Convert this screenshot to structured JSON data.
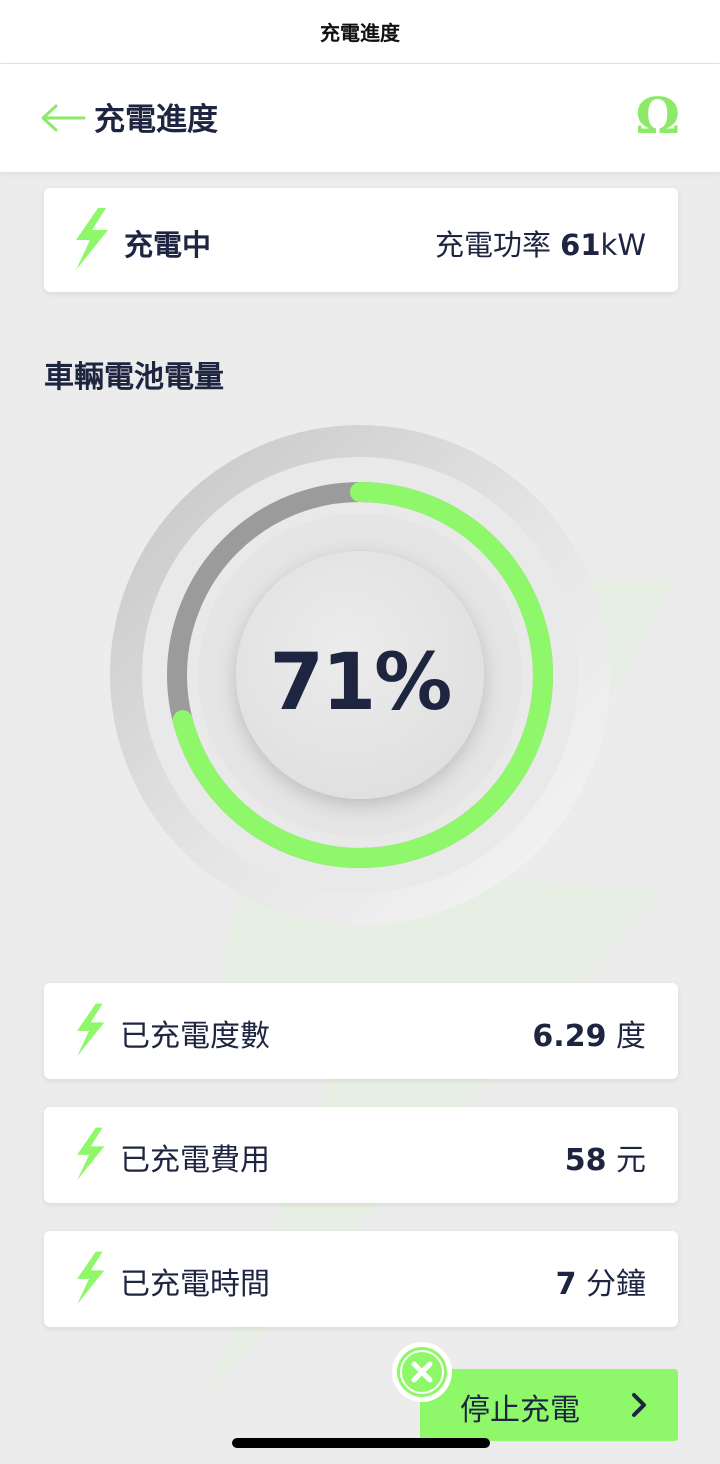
{
  "system": {
    "title": "充電進度"
  },
  "header": {
    "title": "充電進度",
    "omega": "Ω"
  },
  "status": {
    "label": "充電中",
    "power_label": "充電功率",
    "power_value": "61",
    "power_unit": "kW"
  },
  "battery": {
    "section_title": "車輛電池電量",
    "percent_text": "71%",
    "percent_value": 71
  },
  "stats": [
    {
      "label": "已充電度數",
      "value": "6.29",
      "unit": "度"
    },
    {
      "label": "已充電費用",
      "value": "58",
      "unit": "元"
    },
    {
      "label": "已充電時間",
      "value": "7",
      "unit": "分鐘"
    }
  ],
  "stop": {
    "label": "停止充電"
  },
  "colors": {
    "accent_green": "#8ef86a",
    "text_dark": "#1e2540",
    "background": "#ececec"
  },
  "icons": {
    "back": "arrow-left-icon",
    "omega": "omega-icon",
    "bolt": "lightning-bolt-icon",
    "stop": "close-circle-icon",
    "chevron": "chevron-right-icon"
  }
}
